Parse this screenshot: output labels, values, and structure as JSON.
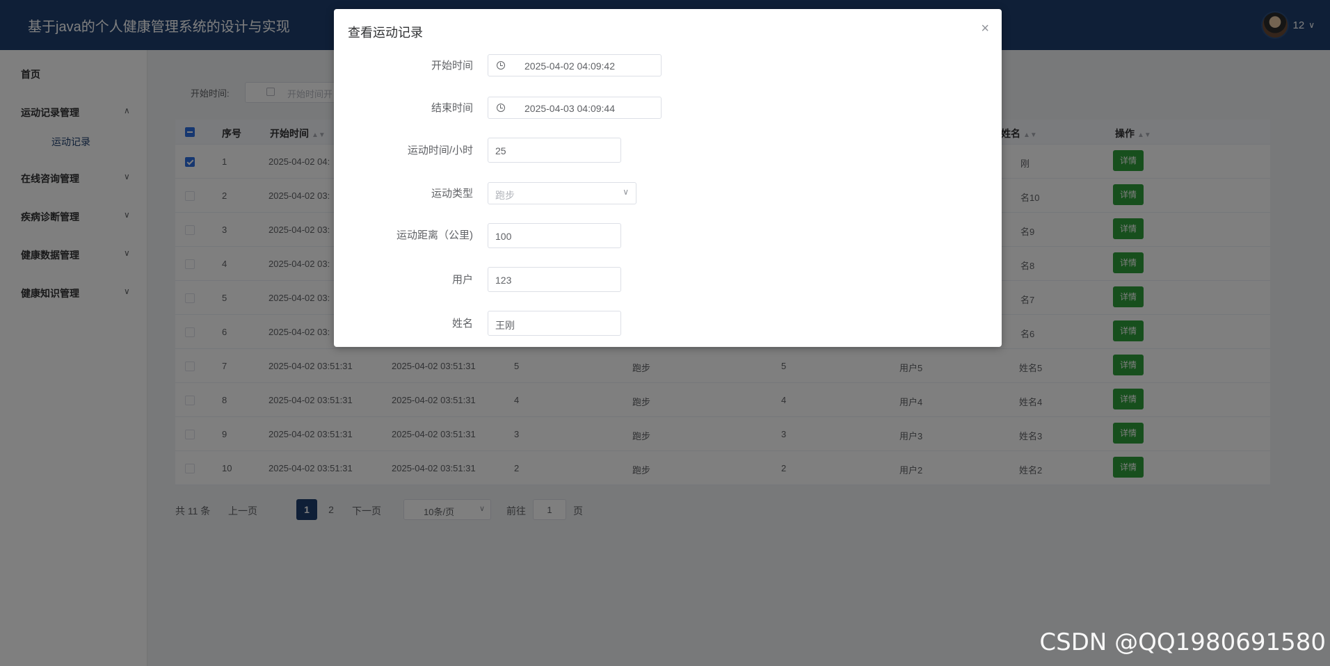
{
  "app": {
    "title": "基于java的个人健康管理系统的设计与实现",
    "user": "12"
  },
  "sidebar": {
    "home": "首页",
    "groups": [
      {
        "label": "运动记录管理",
        "expanded": true,
        "children": [
          "运动记录"
        ]
      },
      {
        "label": "在线咨询管理",
        "expanded": false
      },
      {
        "label": "疾病诊断管理",
        "expanded": false
      },
      {
        "label": "健康数据管理",
        "expanded": false
      },
      {
        "label": "健康知识管理",
        "expanded": false
      }
    ]
  },
  "filter": {
    "label": "开始时间:",
    "placeholder": "开始时间开"
  },
  "table": {
    "headers": {
      "index": "序号",
      "start": "开始时间",
      "name": "姓名",
      "ops": "操作"
    },
    "detail_label": "详情",
    "rows": [
      {
        "idx": "1",
        "start": "2025-04-02 04:",
        "name": "刚",
        "checked": true
      },
      {
        "idx": "2",
        "start": "2025-04-02 03:",
        "name": "名10"
      },
      {
        "idx": "3",
        "start": "2025-04-02 03:",
        "name": "名9"
      },
      {
        "idx": "4",
        "start": "2025-04-02 03:",
        "name": "名8"
      },
      {
        "idx": "5",
        "start": "2025-04-02 03:",
        "name": "名7"
      },
      {
        "idx": "6",
        "start": "2025-04-02 03:",
        "name": "名6"
      },
      {
        "idx": "7",
        "start": "2025-04-02 03:51:31",
        "end": "2025-04-02 03:51:31",
        "hours": "5",
        "type": "跑步",
        "dist": "5",
        "user": "用户5",
        "name": "姓名5"
      },
      {
        "idx": "8",
        "start": "2025-04-02 03:51:31",
        "end": "2025-04-02 03:51:31",
        "hours": "4",
        "type": "跑步",
        "dist": "4",
        "user": "用户4",
        "name": "姓名4"
      },
      {
        "idx": "9",
        "start": "2025-04-02 03:51:31",
        "end": "2025-04-02 03:51:31",
        "hours": "3",
        "type": "跑步",
        "dist": "3",
        "user": "用户3",
        "name": "姓名3"
      },
      {
        "idx": "10",
        "start": "2025-04-02 03:51:31",
        "end": "2025-04-02 03:51:31",
        "hours": "2",
        "type": "跑步",
        "dist": "2",
        "user": "用户2",
        "name": "姓名2"
      }
    ]
  },
  "pager": {
    "total": "共 11 条",
    "prev": "上一页",
    "pages": [
      "1",
      "2"
    ],
    "active": "1",
    "next": "下一页",
    "page_size": "10条/页",
    "goto": "前往",
    "goto_value": "1",
    "page_suffix": "页"
  },
  "dialog": {
    "title": "查看运动记录",
    "close": "×",
    "fields": {
      "start_label": "开始时间",
      "start_value": "2025-04-02 04:09:42",
      "end_label": "结束时间",
      "end_value": "2025-04-03 04:09:44",
      "hours_label": "运动时间/小时",
      "hours_value": "25",
      "type_label": "运动类型",
      "type_value": "跑步",
      "dist_label": "运动距离（公里)",
      "dist_value": "100",
      "user_label": "用户",
      "user_value": "123",
      "name_label": "姓名",
      "name_value": "王刚"
    }
  },
  "watermark": "CSDN @QQ1980691580"
}
